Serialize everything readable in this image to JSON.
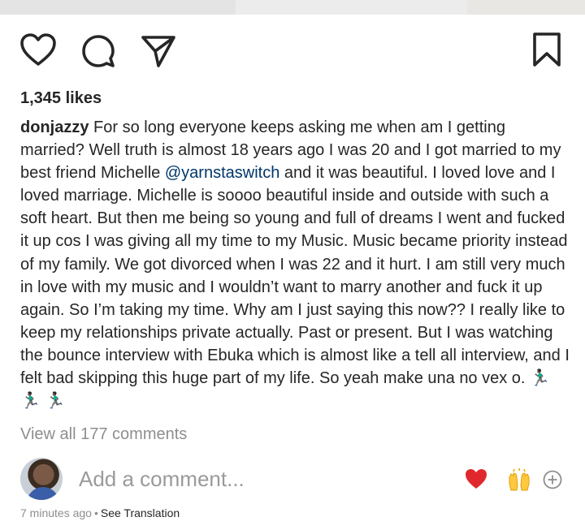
{
  "post": {
    "likes_text": "1,345 likes",
    "username": "donjazzy",
    "caption_part1": "For so long everyone keeps asking me when am I getting married? Well truth is almost 18 years ago I was 20 and I got married to my best friend Michelle ",
    "mention": "@yarnstaswitch",
    "caption_part2": " and it was beautiful. I loved love and I loved marriage. Michelle is soooo beautiful inside and outside with such a soft heart. But then me being so young and full of dreams I went and fucked it up cos I was giving all my time to my Music. Music became priority instead of my family. We got divorced when I was 22 and it hurt. I am still very much in love with my music and I wouldn’t want to marry another and fuck it up again. So I’m taking my time. Why am I just saying this now?? I really like to keep my relationships private actually. Past or present. But I was watching the bounce interview with Ebuka which is almost like a tell all interview, and I felt bad skipping this huge part of my life. So yeah make una no vex o. ",
    "caption_emojis": "🏃🏿‍♂️ 🏃🏿‍♂️ 🏃🏿‍♂️",
    "view_comments": "View all 177 comments",
    "timestamp": "7 minutes ago",
    "separator": "•",
    "see_translation": "See Translation"
  },
  "comment_box": {
    "placeholder": "Add a comment...",
    "quick_reactions": [
      "❤️",
      "🙌"
    ]
  },
  "icons": {
    "like": "heart-outline-icon",
    "comment": "comment-bubble-icon",
    "share": "paper-plane-icon",
    "save": "bookmark-icon",
    "add_emoji": "plus-circle-icon"
  },
  "colors": {
    "text": "#262626",
    "muted": "#8e8e8e",
    "mention": "#00376b",
    "heart": "#ed4956"
  }
}
